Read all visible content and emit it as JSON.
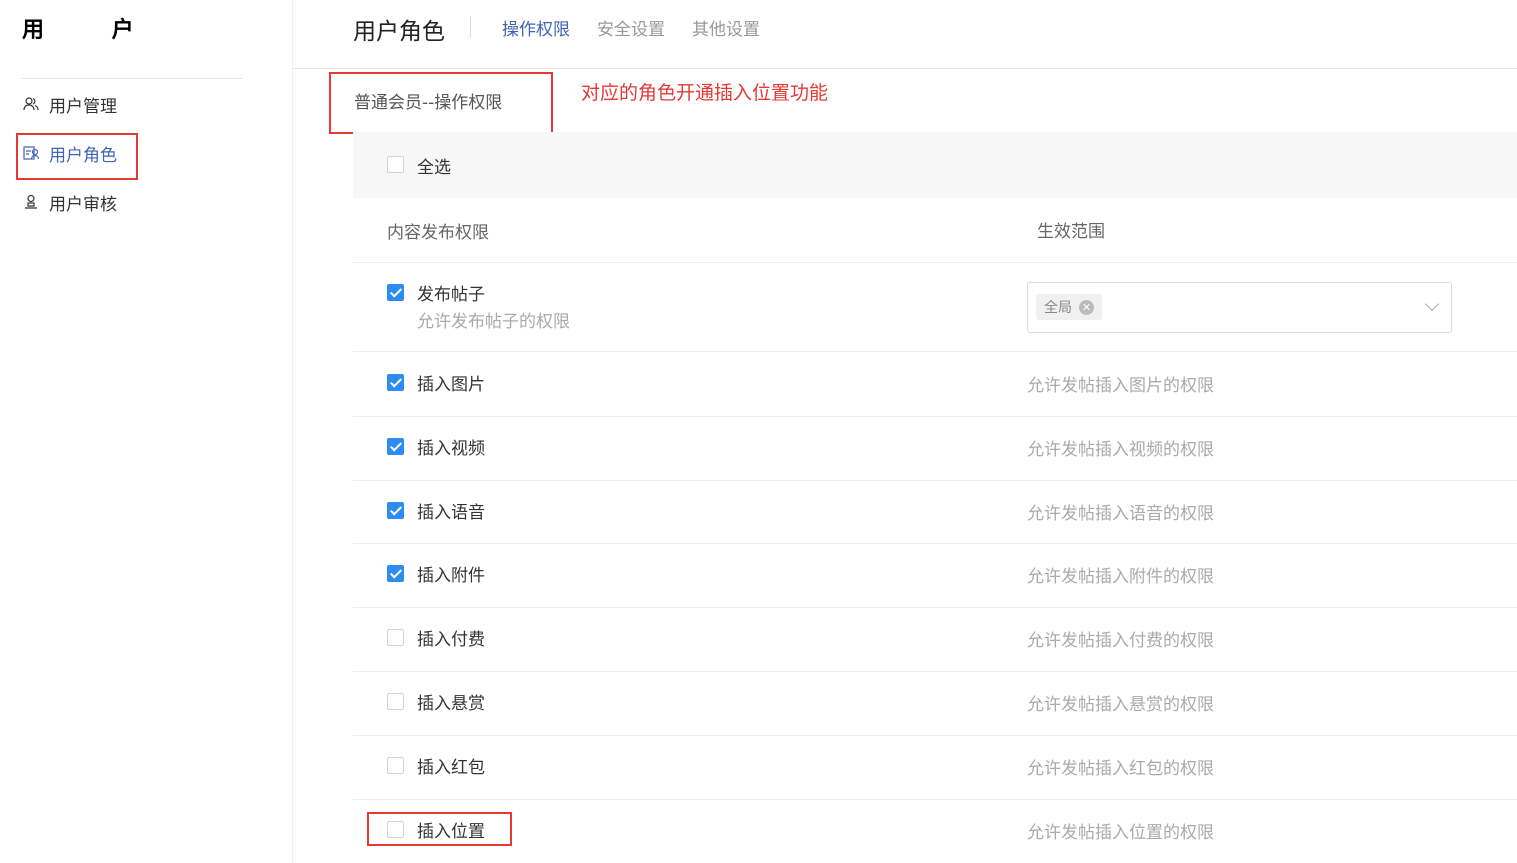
{
  "sidebar": {
    "title": "用 户",
    "items": [
      {
        "label": "用户管理",
        "icon": "users-icon"
      },
      {
        "label": "用户角色",
        "icon": "role-card-icon",
        "active": true
      },
      {
        "label": "用户审核",
        "icon": "user-stamp-icon"
      }
    ]
  },
  "header": {
    "title": "用户角色",
    "tabs": [
      {
        "label": "操作权限",
        "active": true
      },
      {
        "label": "安全设置"
      },
      {
        "label": "其他设置"
      }
    ]
  },
  "section": {
    "title": "普通会员--操作权限",
    "annotation": "对应的角色开通插入位置功能"
  },
  "select_all": {
    "label": "全选",
    "checked": false
  },
  "columns": {
    "permission": "内容发布权限",
    "scope": "生效范围"
  },
  "publish": {
    "label": "发布帖子",
    "sublabel": "允许发布帖子的权限",
    "checked": true,
    "scope_tag": "全局"
  },
  "permissions": [
    {
      "label": "插入图片",
      "desc": "允许发帖插入图片的权限",
      "checked": true
    },
    {
      "label": "插入视频",
      "desc": "允许发帖插入视频的权限",
      "checked": true
    },
    {
      "label": "插入语音",
      "desc": "允许发帖插入语音的权限",
      "checked": true
    },
    {
      "label": "插入附件",
      "desc": "允许发帖插入附件的权限",
      "checked": true
    },
    {
      "label": "插入付费",
      "desc": "允许发帖插入付费的权限",
      "checked": false
    },
    {
      "label": "插入悬赏",
      "desc": "允许发帖插入悬赏的权限",
      "checked": false
    },
    {
      "label": "插入红包",
      "desc": "允许发帖插入红包的权限",
      "checked": false
    },
    {
      "label": "插入位置",
      "desc": "允许发帖插入位置的权限",
      "checked": false
    }
  ],
  "colors": {
    "accent": "#3f64b5",
    "checkbox_checked": "#2d8cf0",
    "annotation_red": "#e53935"
  }
}
